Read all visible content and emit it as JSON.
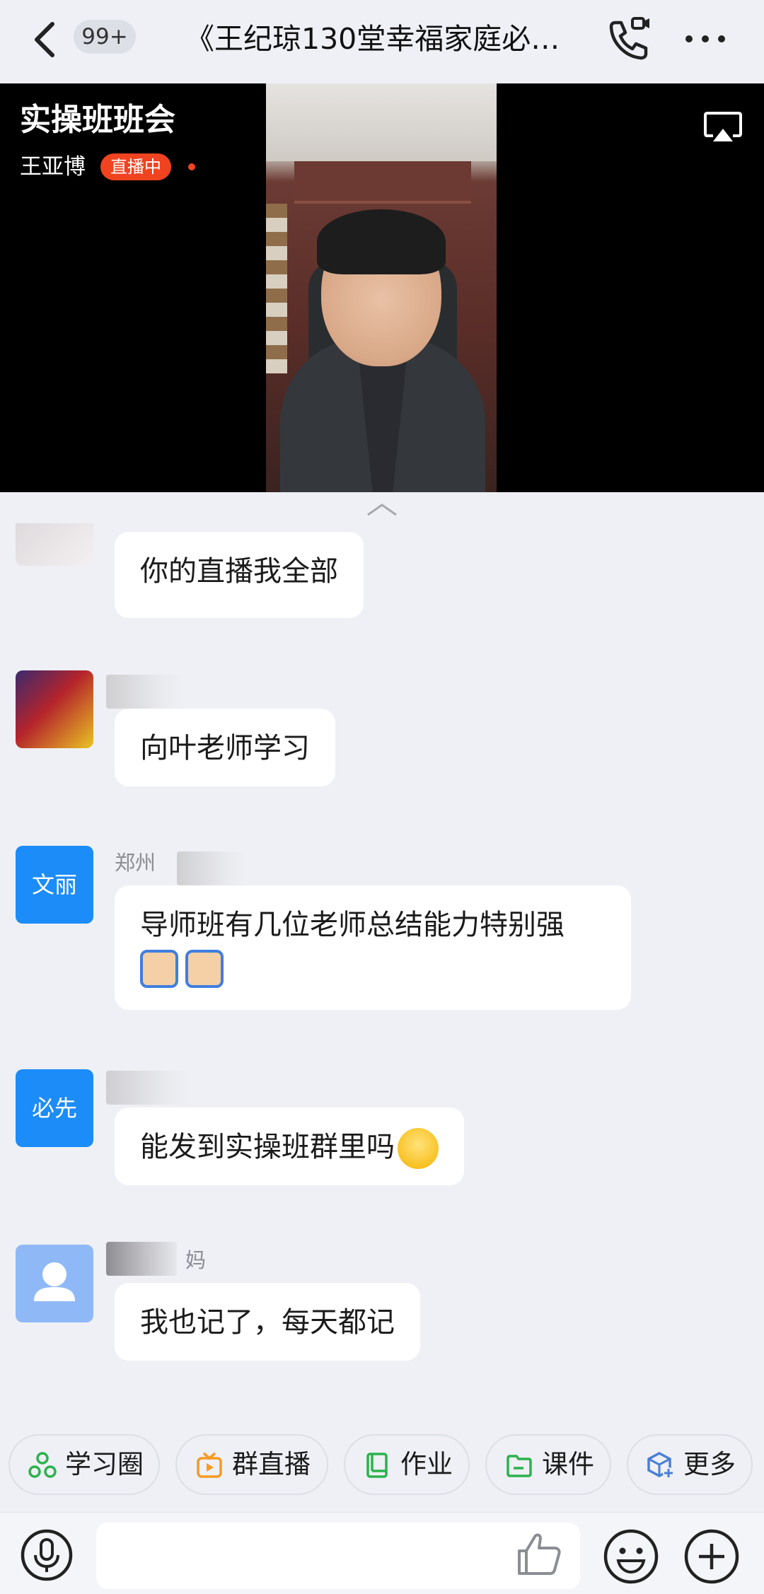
{
  "header": {
    "unread_badge": "99+",
    "title": "《王纪琼130堂幸福家庭必…"
  },
  "live": {
    "title": "实操班班会",
    "host": "王亚博",
    "status": "直播中"
  },
  "messages": [
    {
      "sender": "",
      "avatar_text": "",
      "text": "你的直播我全部"
    },
    {
      "sender": "",
      "avatar_text": "",
      "text": "向叶老师学习"
    },
    {
      "sender": "郑州",
      "avatar_text": "文丽",
      "text": "导师班有几位老师总结能力特别强"
    },
    {
      "sender": "",
      "avatar_text": "必先",
      "text": "能发到实操班群里吗"
    },
    {
      "sender": "妈",
      "avatar_text": "",
      "text": "我也记了，每天都记"
    }
  ],
  "quick_actions": [
    {
      "label": "学习圈",
      "icon": "circle-nodes-icon",
      "color": "#2bb24c"
    },
    {
      "label": "群直播",
      "icon": "live-tv-icon",
      "color": "#f59a23"
    },
    {
      "label": "作业",
      "icon": "book-icon",
      "color": "#2bb24c"
    },
    {
      "label": "课件",
      "icon": "folder-icon",
      "color": "#2bb24c"
    },
    {
      "label": "更多",
      "icon": "cube-plus-icon",
      "color": "#4a7fd6"
    }
  ],
  "colors": {
    "live_badge": "#f0431f",
    "avatar_blue": "#1c8cf8",
    "background": "#eef0f5"
  }
}
